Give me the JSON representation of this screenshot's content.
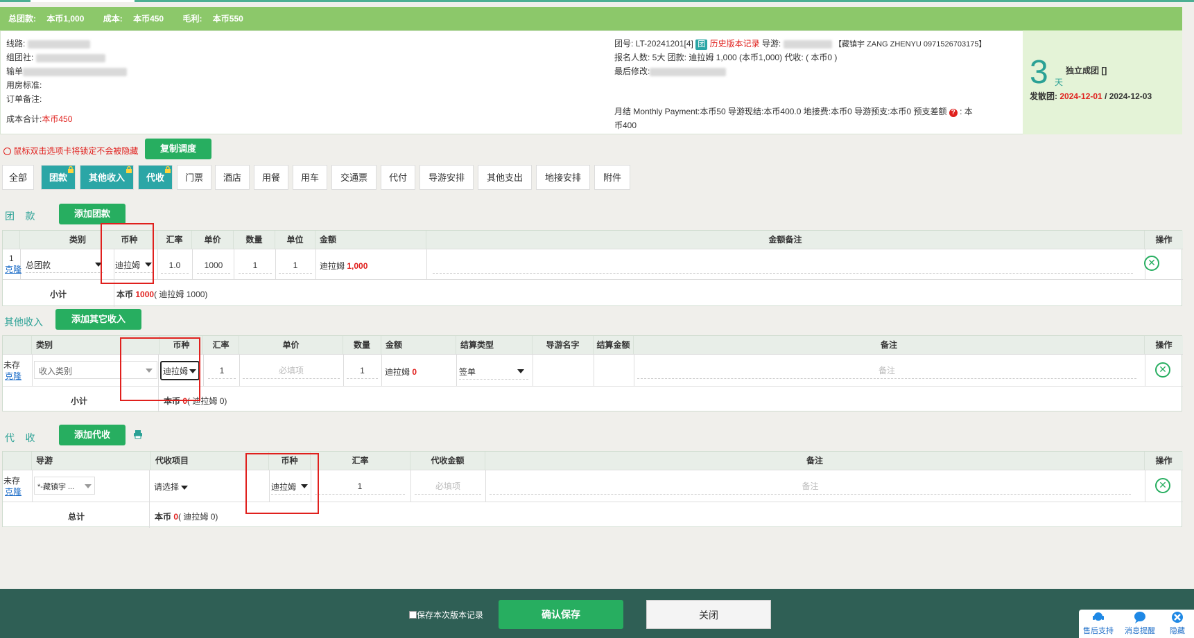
{
  "summary": {
    "total_label": "总团款:",
    "total_value": "本币1,000",
    "cost_label": "成本:",
    "cost_value": "本币450",
    "profit_label": "毛利:",
    "profit_value": "本币550"
  },
  "info": {
    "route_label": "线路:",
    "route_value": "广东5日游",
    "org_label": "组团社:",
    "org_value": "某某国际旅行社",
    "input_label": "输单",
    "input_value": "2024-11-18",
    "room_label": "用房标准:",
    "note_label": "订单备注:",
    "cost_total_label": "成本合计:",
    "cost_total_value": "本币450",
    "group_no_label": "团号:",
    "group_no_value": "LT-20241201[4]",
    "group_tag": "团",
    "history_link": "历史版本记录",
    "guide_label": "导游:",
    "guide_value": "【藏镇宇 ZANG ZHENYU 0971526703175】",
    "signup_line": "报名人数: 5大  团款: 迪拉姆 1,000 (本币1,000) 代收: ( 本币0 )",
    "last_mod_label": "最后修改:",
    "last_mod_value": "某某 2024-11-18 16:47:48",
    "monthly_line": "月结 Monthly Payment:本币50 导游现结:本币400.0   地接费:本币0  导游预支:本币0  预支差额",
    "monthly_line2": "币400",
    "monthly_tail": ": 本"
  },
  "days": {
    "num": "3",
    "unit": "天",
    "type": "独立成团 []",
    "depart_label": "发散团:",
    "start": "2024-12-01",
    "sep": " / ",
    "end": "2024-12-03"
  },
  "hint": "鼠标双击选项卡将锁定不会被隐藏",
  "copy_button": "复制调度",
  "tabs": [
    "全部",
    "团款",
    "其他收入",
    "代收",
    "门票",
    "酒店",
    "用餐",
    "用车",
    "交通票",
    "代付",
    "导游安排",
    "其他支出",
    "地接安排",
    "附件"
  ],
  "tuankuan": {
    "title": "团    款",
    "add_button": "添加团款",
    "headers": [
      "类别",
      "币种",
      "汇率",
      "单价",
      "数量",
      "单位",
      "金额",
      "金额备注",
      "操作"
    ],
    "row": {
      "index": "1",
      "clone": "克隆",
      "category": "总团款",
      "currency": "迪拉姆",
      "rate": "1.0",
      "price": "1000",
      "qty": "1",
      "unit": "1",
      "amount_cur": "迪拉姆",
      "amount": "1,000"
    },
    "subtotal_label": "小计",
    "subtotal_prefix": "本币",
    "subtotal_value": "1000",
    "subtotal_suffix": "( 迪拉姆 1000)"
  },
  "other_income": {
    "title": "其他收入",
    "add_button": "添加其它收入",
    "headers": [
      "类别",
      "币种",
      "汇率",
      "单价",
      "数量",
      "金额",
      "结算类型",
      "导游名字",
      "结算金额",
      "备注",
      "操作"
    ],
    "row": {
      "status": "未存",
      "clone": "克隆",
      "category_placeholder": "收入类别",
      "currency": "迪拉姆",
      "rate": "1",
      "price_placeholder": "必填项",
      "qty": "1",
      "amount_cur": "迪拉姆",
      "amount": "0",
      "settle_type": "签单",
      "note_placeholder": "备注"
    },
    "subtotal_label": "小计",
    "subtotal_prefix": "本币",
    "subtotal_value": "0",
    "subtotal_suffix": "( 迪拉姆 0)"
  },
  "daishou": {
    "title": "代    收",
    "add_button": "添加代收",
    "headers": [
      "导游",
      "代收项目",
      "币种",
      "汇率",
      "代收金额",
      "备注",
      "操作"
    ],
    "row": {
      "status": "未存",
      "clone": "克隆",
      "guide": "*-藏镇宇 ...",
      "item": "请选择",
      "currency": "迪拉姆",
      "rate": "1",
      "amount_placeholder": "必填项",
      "note_placeholder": "备注"
    },
    "total_label": "总计",
    "total_prefix": "本币",
    "total_value": "0",
    "total_suffix": "( 迪拉姆 0)"
  },
  "footer": {
    "save_version": "保存本次版本记录",
    "confirm": "确认保存",
    "close": "关闭"
  },
  "help": {
    "support": "售后支持",
    "message": "消息提醒",
    "hide": "隐藏"
  }
}
